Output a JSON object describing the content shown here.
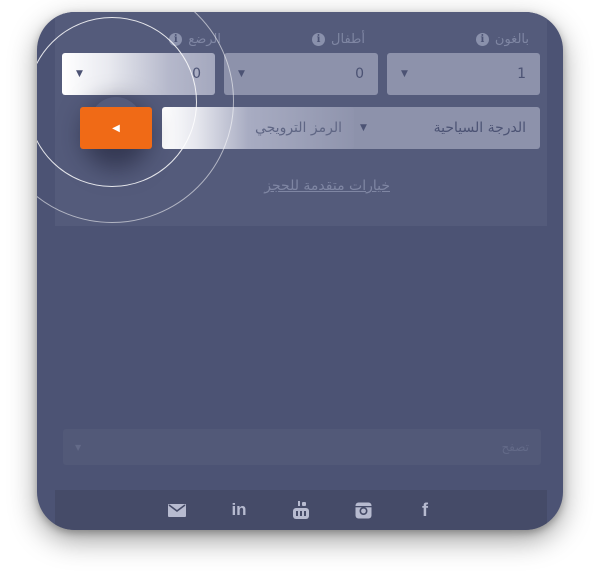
{
  "labels": {
    "adults": "بالغون",
    "children": "أطفال",
    "infants": "الرضع"
  },
  "fields": {
    "adults_value": "1",
    "children_value": "0",
    "infants_value": "0",
    "class_value": "الدرجة السياحية",
    "promo_placeholder": "الرمز الترويجي"
  },
  "links": {
    "advanced": "خيارات متقدمة للحجز"
  },
  "language_select": {
    "value": "تصفح"
  },
  "colors": {
    "card_bg": "#4c5374",
    "accent_button": "#f06a16"
  },
  "icons": [
    "info-icon",
    "caret-down-icon",
    "arrow-left-icon",
    "mail-icon",
    "linkedin-icon",
    "youtube-icon",
    "instagram-icon",
    "facebook-icon"
  ]
}
